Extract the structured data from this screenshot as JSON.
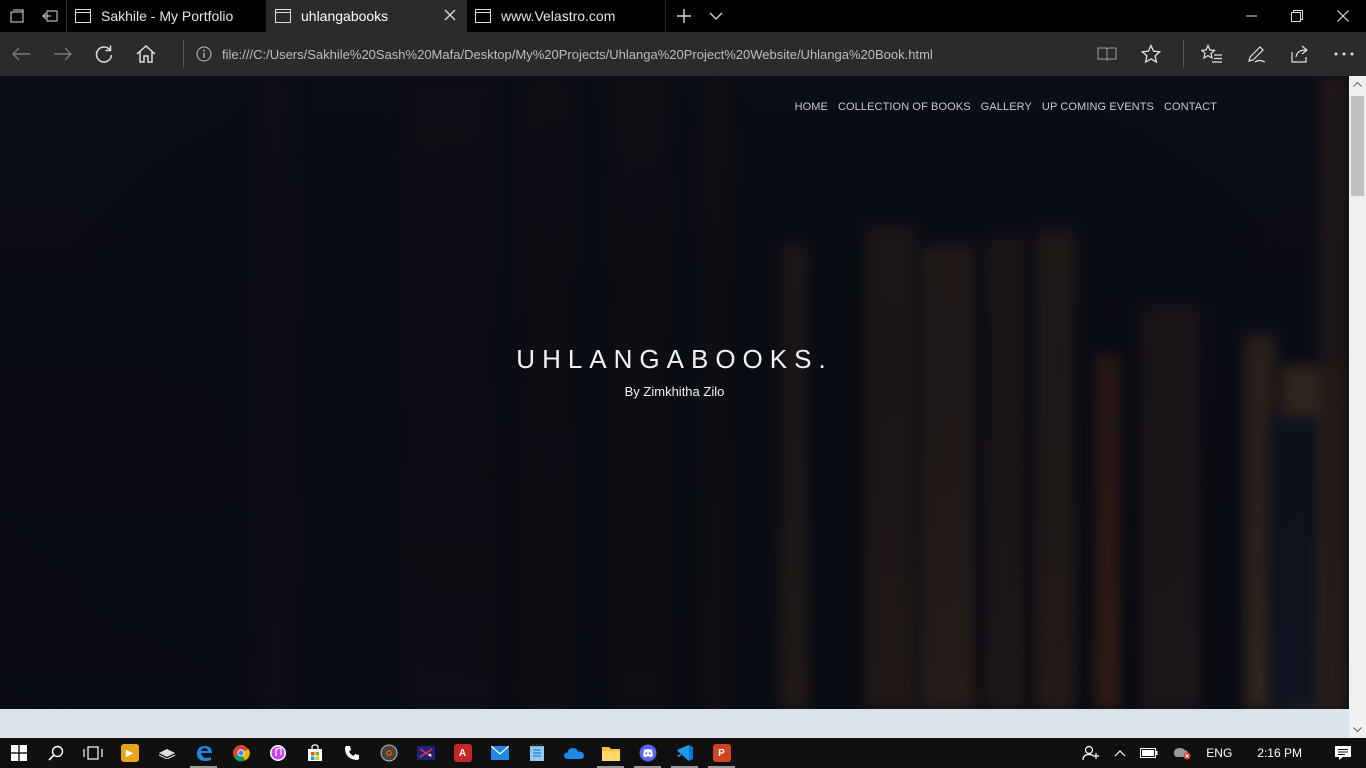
{
  "browser": {
    "tabs": [
      {
        "title": "Sakhile - My Portfolio",
        "active": false
      },
      {
        "title": "uhlangabooks",
        "active": true
      },
      {
        "title": "www.Velastro.com",
        "active": false
      }
    ],
    "address": "file:///C:/Users/Sakhile%20Sash%20Mafa/Desktop/My%20Projects/Uhlanga%20Project%20Website/Uhlanga%20Book.html"
  },
  "site": {
    "nav": [
      {
        "label": "HOME"
      },
      {
        "label": "COLLECTION OF BOOKS"
      },
      {
        "label": "GALLERY"
      },
      {
        "label": "UP COMING EVENTS"
      },
      {
        "label": "CONTACT"
      }
    ],
    "title": "UHLANGABOOKS.",
    "subtitle": "By Zimkhitha Zilo"
  },
  "taskbar": {
    "apps": [
      "start-icon",
      "search-icon",
      "task-view-icon",
      "media-player-icon",
      "keyboard-app-icon",
      "edge-icon",
      "chrome-icon",
      "itunes-icon",
      "store-icon",
      "phone-icon",
      "media-disc-icon",
      "network-app-icon",
      "acrobat-icon",
      "mail-icon",
      "notepad-icon",
      "onedrive-icon",
      "file-explorer-icon",
      "discord-icon",
      "vscode-icon",
      "powerpoint-icon"
    ],
    "language": "ENG",
    "time": "2:16 PM"
  },
  "colors": {
    "tab_bar": "#000000",
    "address_bar": "#2b2b2b",
    "hero_bg": "#0d0f19",
    "below_hero": "#dde3ea"
  }
}
